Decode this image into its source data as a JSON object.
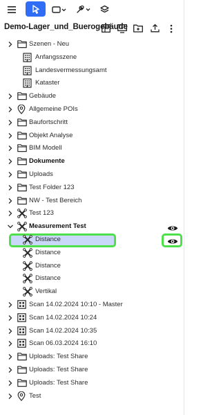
{
  "project": {
    "title": "Demo-Lager_und_Buerogebäude"
  },
  "toolbar": {
    "items": [
      {
        "name": "menu",
        "icon": "hamburger-icon"
      },
      {
        "name": "select",
        "icon": "cursor-arrow-icon",
        "active": true
      },
      {
        "name": "shape",
        "icon": "rectangle-dropdown-icon"
      },
      {
        "name": "measure",
        "icon": "tool-dropdown-icon"
      },
      {
        "name": "layers",
        "icon": "layers-icon"
      }
    ]
  },
  "header_icons": [
    "grid-view-icon",
    "present-icon",
    "folder-open-icon",
    "upload-icon",
    "more-vertical-icon"
  ],
  "tree": [
    {
      "label": "Szenen - Neu",
      "icon": "folder-icon",
      "chevron": "right",
      "indent": 0
    },
    {
      "label": "Anfangsszene",
      "icon": "building-icon",
      "indent": 1
    },
    {
      "label": "Landesvermessungsamt",
      "icon": "building-icon",
      "indent": 1
    },
    {
      "label": "Kataster",
      "icon": "building-icon",
      "indent": 1
    },
    {
      "label": "Gebäude",
      "icon": "folder-icon",
      "chevron": "right",
      "indent": 0
    },
    {
      "label": "Allgemeine POIs",
      "icon": "pin-icon",
      "chevron": "right",
      "indent": 0
    },
    {
      "label": "Baufortschritt",
      "icon": "folder-icon",
      "chevron": "right",
      "indent": 0
    },
    {
      "label": "Objekt Analyse",
      "icon": "folder-icon",
      "chevron": "right",
      "indent": 0
    },
    {
      "label": "BIM Modell",
      "icon": "folder-icon",
      "chevron": "right",
      "indent": 0
    },
    {
      "label": "Dokumente",
      "icon": "folder-icon",
      "chevron": "right",
      "indent": 0,
      "bold": true
    },
    {
      "label": "Uploads",
      "icon": "folder-icon",
      "chevron": "right",
      "indent": 0
    },
    {
      "label": "Test Folder 123",
      "icon": "folder-icon",
      "chevron": "right",
      "indent": 0
    },
    {
      "label": "NW - Test Bereich",
      "icon": "folder-icon",
      "chevron": "right",
      "indent": 0
    },
    {
      "label": "Test 123",
      "icon": "measure-icon",
      "chevron": "right",
      "indent": 0
    },
    {
      "label": "Measurement Test",
      "icon": "measure-icon",
      "chevron": "down",
      "indent": 0,
      "bold": true,
      "eye": true
    },
    {
      "label": "Distance",
      "icon": "measure-icon",
      "indent": 1,
      "selected": true,
      "eye": true,
      "eye_highlight": true
    },
    {
      "label": "Distance",
      "icon": "measure-icon",
      "indent": 1
    },
    {
      "label": "Distance",
      "icon": "measure-icon",
      "indent": 1
    },
    {
      "label": "Distance",
      "icon": "measure-icon",
      "indent": 1
    },
    {
      "label": "Vertikal",
      "icon": "measure-icon",
      "indent": 1
    },
    {
      "label": "Scan 14.02.2024 10:10 - Master",
      "icon": "scan-icon",
      "chevron": "right",
      "indent": 0
    },
    {
      "label": "Scan 14.02.2024 10:24",
      "icon": "scan-icon",
      "chevron": "right",
      "indent": 0
    },
    {
      "label": "Scan 14.02.2024 10:35",
      "icon": "scan-icon",
      "chevron": "right",
      "indent": 0
    },
    {
      "label": "Scan 06.03.2024 16:10",
      "icon": "scan-icon",
      "chevron": "right",
      "indent": 0
    },
    {
      "label": "Uploads: Test Share",
      "icon": "folder-icon",
      "chevron": "right",
      "indent": 0
    },
    {
      "label": "Uploads: Test Share",
      "icon": "folder-icon",
      "chevron": "right",
      "indent": 0
    },
    {
      "label": "Uploads: Test Share",
      "icon": "folder-icon",
      "chevron": "right",
      "indent": 0
    },
    {
      "label": "Test",
      "icon": "pin-icon",
      "chevron": "right",
      "indent": 0
    }
  ],
  "colors": {
    "accent": "#2f6df6",
    "selection": "#c9d8f8",
    "highlight": "#4ee04a",
    "icon": "#2b2b2b"
  }
}
